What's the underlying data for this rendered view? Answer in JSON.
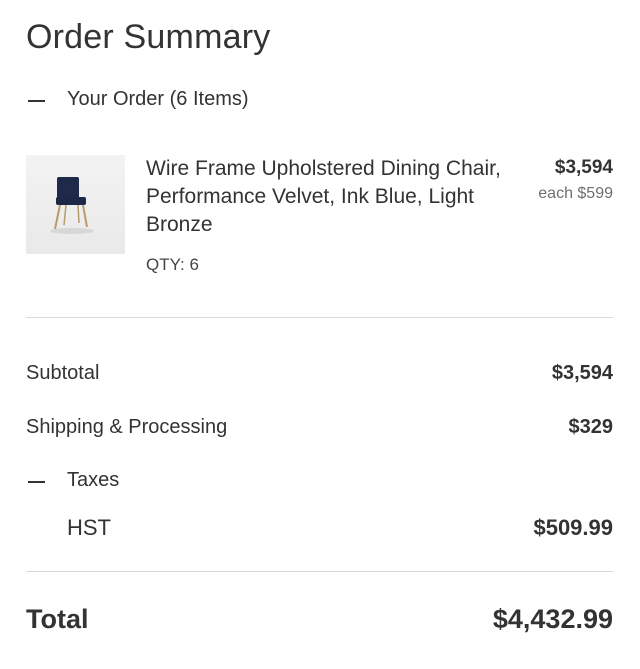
{
  "header": {
    "title": "Order Summary"
  },
  "order": {
    "toggle_label": "Your Order (6 Items)",
    "item": {
      "image_icon": "chair-thumbnail",
      "name": "Wire Frame Upholstered Dining Chair, Performance Velvet, Ink Blue, Light Bronze",
      "qty": "QTY: 6",
      "price": "$3,594",
      "each": "each $599"
    }
  },
  "summary": {
    "subtotal_label": "Subtotal",
    "subtotal_value": "$3,594",
    "shipping_label": "Shipping & Processing",
    "shipping_value": "$329",
    "taxes_label": "Taxes",
    "hst_label": "HST",
    "hst_value": "$509.99"
  },
  "total": {
    "label": "Total",
    "value": "$4,432.99"
  },
  "icons": {
    "collapse": "minus-icon"
  }
}
